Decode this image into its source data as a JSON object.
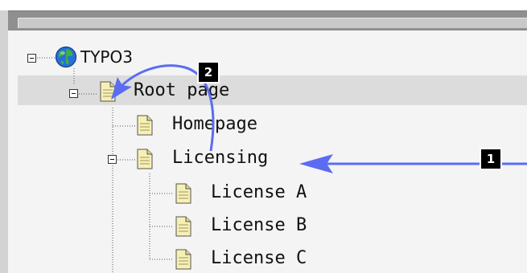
{
  "tree": {
    "root": {
      "label": "TYPO3",
      "icon": "globe-icon"
    },
    "root_page": {
      "label": "Root page",
      "icon": "page-icon"
    },
    "nodes": [
      {
        "label": "Homepage",
        "icon": "page-icon"
      },
      {
        "label": "Licensing",
        "icon": "page-icon"
      },
      {
        "label": "License A",
        "icon": "page-icon"
      },
      {
        "label": "License B",
        "icon": "page-icon"
      },
      {
        "label": "License C",
        "icon": "page-icon"
      }
    ]
  },
  "callouts": [
    {
      "number": "1"
    },
    {
      "number": "2"
    }
  ],
  "colors": {
    "arrow": "#5b6cf2",
    "selected_row": "#dcdcdc",
    "panel_bg": "#f4f4f4",
    "frame": "#8f8f8f"
  }
}
